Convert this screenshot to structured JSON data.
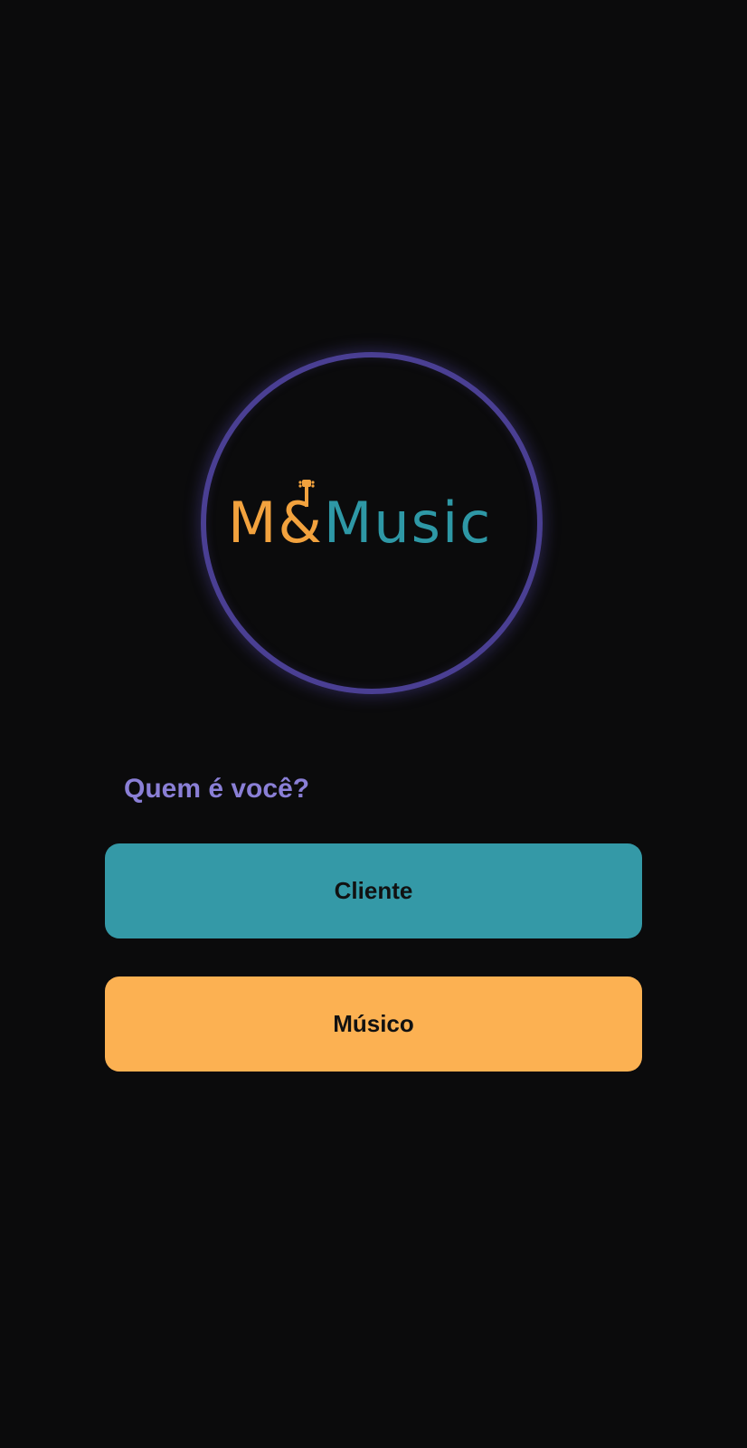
{
  "logo": {
    "part1": "M",
    "part2": "&",
    "part3": "Music",
    "colors": {
      "orange": "#f2a23e",
      "teal": "#2e98a6",
      "ring": "#4a3f93"
    },
    "icon": "guitar-neck-icon"
  },
  "prompt": {
    "question": "Quem é você?"
  },
  "buttons": {
    "cliente": {
      "label": "Cliente",
      "color": "#3499a7"
    },
    "musico": {
      "label": "Músico",
      "color": "#fcb152"
    }
  }
}
